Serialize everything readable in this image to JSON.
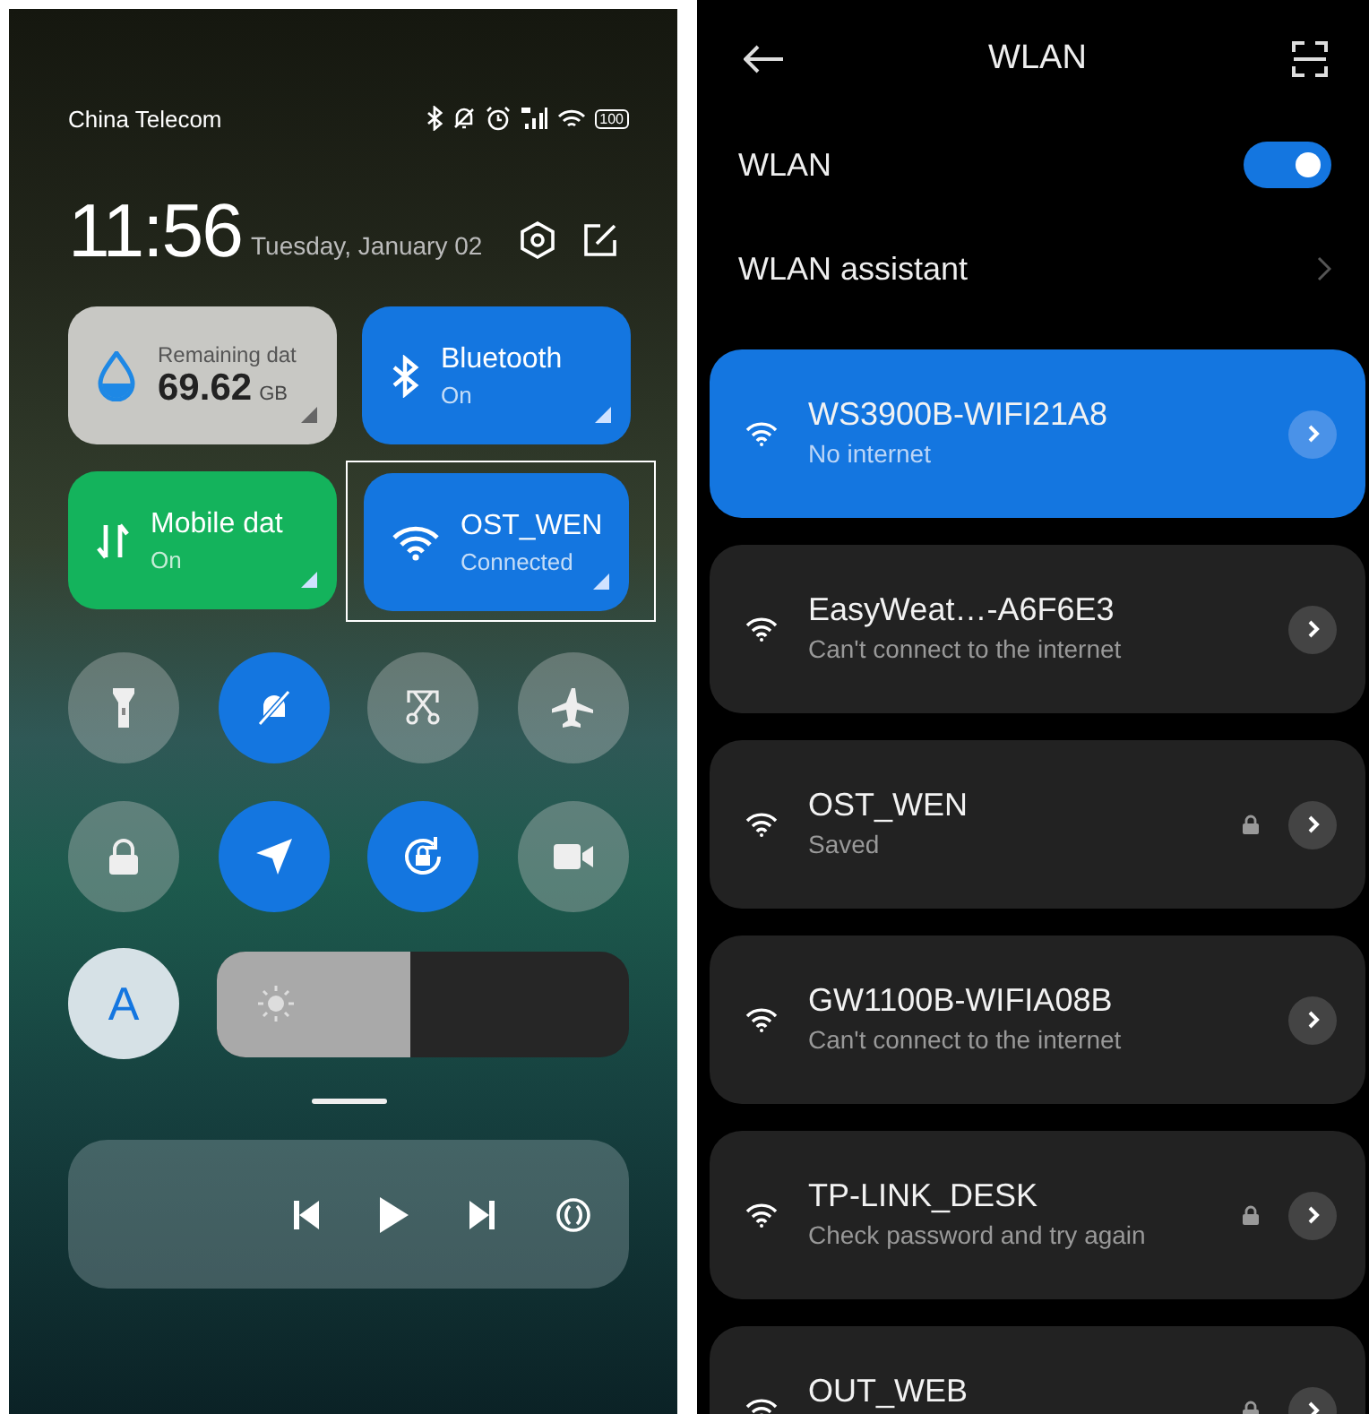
{
  "control_center": {
    "status_bar": {
      "carrier": "China Telecom",
      "battery": "100"
    },
    "clock": {
      "time": "11:56",
      "date": "Tuesday, January 02"
    },
    "tiles": [
      {
        "kind": "data",
        "label": "Remaining dat",
        "value": "69.62",
        "unit": "GB",
        "on": false,
        "highlighted": false
      },
      {
        "kind": "bluetooth",
        "label": "Bluetooth",
        "status": "On",
        "on": true,
        "color": "#1476e0",
        "highlighted": false
      },
      {
        "kind": "mobile",
        "label": "Mobile dat",
        "status": "On",
        "on": true,
        "color": "#14b35c",
        "highlighted": false
      },
      {
        "kind": "wifi",
        "label": "OST_WEN",
        "status": "Connected",
        "on": true,
        "color": "#1476e0",
        "highlighted": true
      }
    ],
    "toggles": [
      {
        "kind": "flashlight",
        "on": false
      },
      {
        "kind": "silent",
        "on": true
      },
      {
        "kind": "screenshot",
        "on": false
      },
      {
        "kind": "airplane",
        "on": false
      },
      {
        "kind": "lock",
        "on": false
      },
      {
        "kind": "location",
        "on": true
      },
      {
        "kind": "rotation",
        "on": true
      },
      {
        "kind": "video",
        "on": false
      }
    ],
    "auto_brightness": {
      "label": "A"
    },
    "brightness": {
      "level": 0.47
    }
  },
  "wlan": {
    "title": "WLAN",
    "toggle": {
      "label": "WLAN",
      "on": true
    },
    "assistant": {
      "label": "WLAN assistant"
    },
    "networks": [
      {
        "name": "WS3900B-WIFI21A8",
        "status": "No internet",
        "secured": false,
        "selected": true
      },
      {
        "name": "EasyWeat…-A6F6E3",
        "status": "Can't connect to the internet",
        "secured": false,
        "selected": false
      },
      {
        "name": "OST_WEN",
        "status": "Saved",
        "secured": true,
        "selected": false
      },
      {
        "name": "GW1100B-WIFIA08B",
        "status": "Can't connect to the internet",
        "secured": false,
        "selected": false
      },
      {
        "name": "TP-LINK_DESK",
        "status": "Check password and try again",
        "secured": true,
        "selected": false
      },
      {
        "name": "OUT_WEB",
        "secured": true,
        "selected": false
      }
    ]
  }
}
